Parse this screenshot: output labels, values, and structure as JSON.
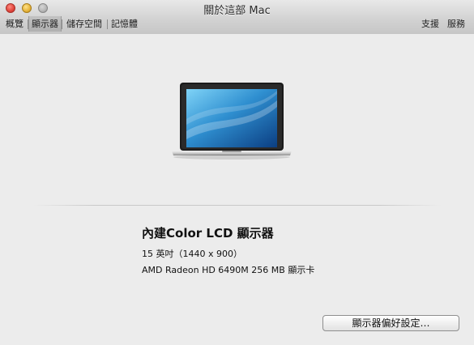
{
  "window": {
    "title": "關於這部 Mac"
  },
  "tabs": [
    {
      "label": "概覽"
    },
    {
      "label": "顯示器"
    },
    {
      "label": "儲存空間"
    },
    {
      "label": "記憶體"
    }
  ],
  "right_links": {
    "support": "支援",
    "service": "服務"
  },
  "display": {
    "name": "內建Color LCD 顯示器",
    "size_resolution": "15 英吋（1440 x 900）",
    "graphics": "AMD Radeon HD 6490M 256 MB 顯示卡"
  },
  "buttons": {
    "display_prefs": "顯示器偏好設定…"
  },
  "active_tab_index": 1
}
